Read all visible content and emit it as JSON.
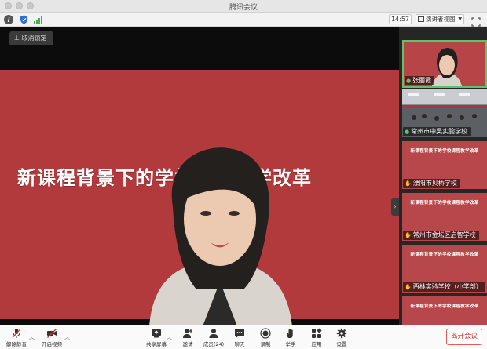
{
  "window": {
    "title": "腾讯会议"
  },
  "toolbar": {
    "clock": "14:57",
    "view_label": "演讲者视图"
  },
  "stage": {
    "unlock_label": "取消锁定",
    "slide_title": "新课程背景下的学校课程教学改革"
  },
  "participants": [
    {
      "name": "张丽霞",
      "icon": "mic-icon",
      "active": true
    },
    {
      "name": "常州市中吴实验学校",
      "icon": "mic-icon",
      "active": false
    },
    {
      "name": "溧阳市贝桥学校",
      "icon": "hand-icon",
      "active": false
    },
    {
      "name": "常州市金坛区启智学校",
      "icon": "hand-icon",
      "active": false
    },
    {
      "name": "西林实验学校（小学部）",
      "icon": "hand-icon",
      "active": false
    }
  ],
  "controls": {
    "unmute": "解除静音",
    "video": "开启视频",
    "share": "共享屏幕",
    "invite": "邀请",
    "members": "成员(24)",
    "chat": "聊天",
    "record": "录制",
    "raise_hand": "举手",
    "apps": "应用",
    "settings": "设置",
    "leave": "离开会议"
  },
  "colors": {
    "slide_red": "#b23a3c",
    "active_border": "#5fc36a",
    "leave_red": "#d0302b"
  }
}
